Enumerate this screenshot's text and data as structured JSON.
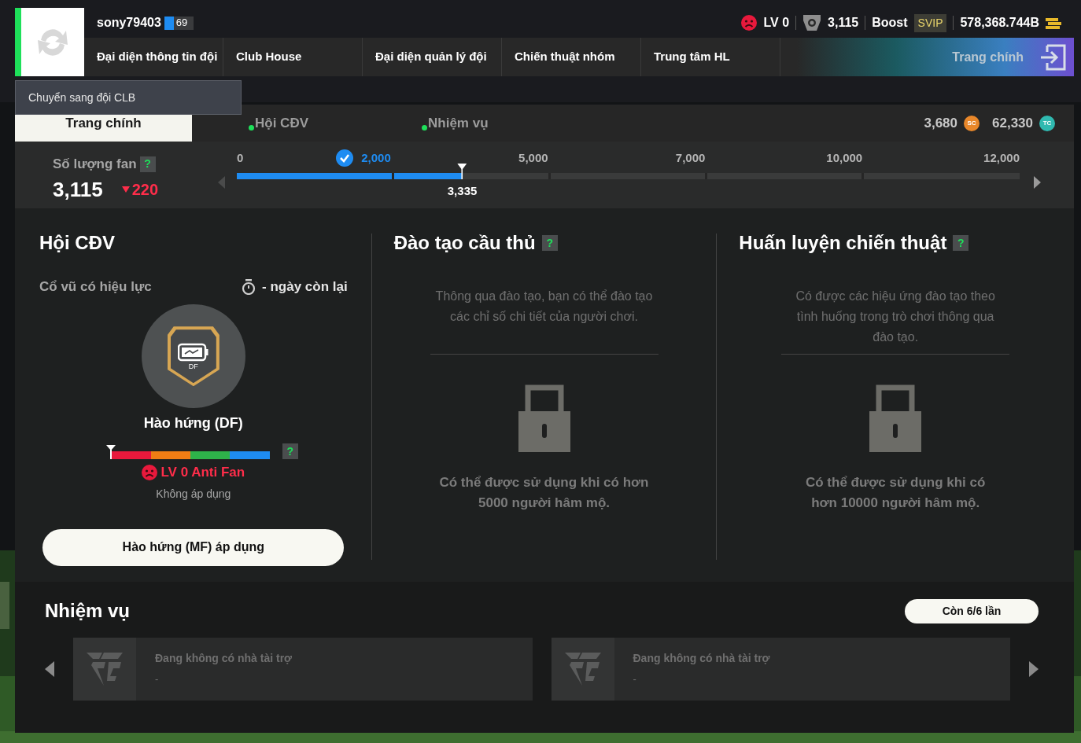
{
  "user": {
    "name": "sony79403",
    "level": "69"
  },
  "status": {
    "mood_level": "LV 0",
    "fans": "3,115",
    "boost_label": "Boost",
    "boost_tier": "SVIP",
    "balance": "578,368.744B"
  },
  "nav": [
    {
      "label": "Đại diện thông tin đội"
    },
    {
      "label": "Club House"
    },
    {
      "label": "Đại diện quản lý đội"
    },
    {
      "label": "Chiến thuật nhóm"
    },
    {
      "label": "Trung tâm HL"
    }
  ],
  "home_button": {
    "label": "Trang chính"
  },
  "switch_tooltip": "Chuyển sang đội CLB",
  "tabs": [
    {
      "label": "Trang chính",
      "selected": true,
      "new": false
    },
    {
      "label": "Hội CĐV",
      "selected": false,
      "new": true
    },
    {
      "label": "Nhiệm vụ",
      "selected": false,
      "new": true
    }
  ],
  "currencies": [
    {
      "amount": "3,680",
      "kind": "sc",
      "symbol": "SC"
    },
    {
      "amount": "62,330",
      "kind": "tc",
      "symbol": "TC"
    }
  ],
  "fans": {
    "label": "Số lượng fan",
    "help": "?",
    "count": "3,115",
    "change": "220",
    "start_tick": "0",
    "current": "3,335",
    "level": 0.288,
    "segments": [
      {
        "tick": "2,000",
        "reached": true
      },
      {
        "tick": "5,000",
        "reached": false
      },
      {
        "tick": "7,000",
        "reached": false
      },
      {
        "tick": "10,000",
        "reached": false
      },
      {
        "tick": "12,000",
        "reached": false
      }
    ]
  },
  "fan_club": {
    "title": "Hội CĐV",
    "effect_label": "Cổ vũ có hiệu lực",
    "days_left": "- ngày còn lại",
    "badge_position": "DF",
    "effect_name": "Hào hứng (DF)",
    "mood": {
      "level": 0,
      "label": "LV 0 Anti Fan",
      "status": "Không áp dụng",
      "help": "?"
    },
    "apply_button": "Hào hứng (MF) áp dụng"
  },
  "features": [
    {
      "title": "Đào tạo cầu thủ",
      "help": "?",
      "description": "Thông qua đào tạo, bạn có thể đào tạo các chỉ số chi tiết của người chơi.",
      "locked": true,
      "unlock_text": "Có thể được sử dụng khi có hơn 5000 người hâm mộ."
    },
    {
      "title": "Huấn luyện chiến thuật",
      "help": "?",
      "description": "Có được các hiệu ứng đào tạo theo tình huống trong trò chơi thông qua đào tạo.",
      "locked": true,
      "unlock_text": "Có thể được sử dụng khi có hơn 10000 người hâm mộ."
    }
  ],
  "missions": {
    "title": "Nhiệm vụ",
    "remaining": "Còn 6/6 lần",
    "sponsors": [
      {
        "title": "Đang không có nhà tài trợ",
        "detail": "-"
      },
      {
        "title": "Đang không có nhà tài trợ",
        "detail": "-"
      }
    ]
  }
}
